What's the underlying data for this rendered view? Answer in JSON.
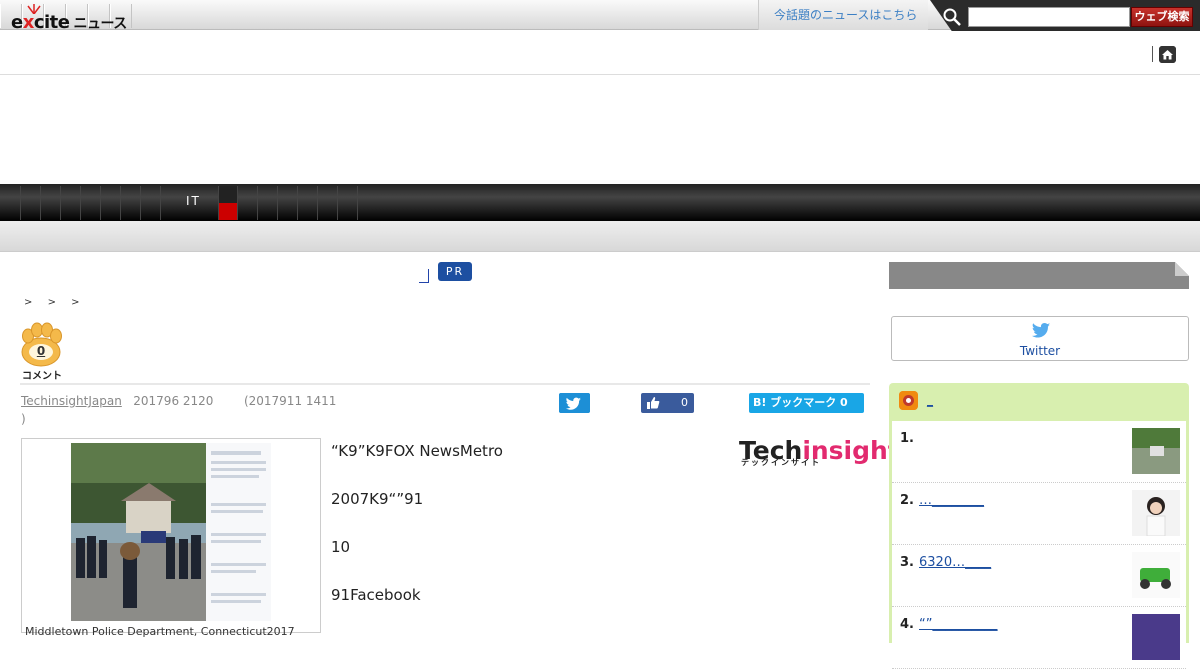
{
  "topbar": {
    "promo_link": "今話題のニュースはこちら",
    "search_placeholder": "",
    "search_button": "ウェブ検索"
  },
  "header": {
    "logo_text_a": "e",
    "logo_text_x": "x",
    "logo_text_b": "cite",
    "logo_news": "ニュース"
  },
  "category_nav": {
    "items": [
      "",
      "",
      "",
      "",
      "",
      "",
      "",
      "",
      "IT",
      "",
      "",
      "",
      "",
      "",
      "",
      "",
      ""
    ],
    "visible_label": "IT"
  },
  "article": {
    "pr_badge": "PR",
    "breadcrumb": [
      ">",
      ">",
      ">"
    ],
    "comment_count": "0",
    "comment_label": "コメント",
    "author": "TechinsightJapan",
    "date": "201796 2120",
    "updated": "(2017911 1411",
    "updated_close": ")",
    "like_count": "0",
    "hatena_label": "B! ブックマーク 0",
    "photo_caption": "Middletown Police Department, Connecticut2017",
    "paragraphs": [
      "“K9”K9FOX NewsMetro",
      "2007K9“”91",
      "10",
      "91Facebook"
    ],
    "source_logo_main": "Tech",
    "source_logo_accent": "insight",
    "source_logo_sub": "テックインサイト"
  },
  "sidebar": {
    "twitter_label": "Twitter",
    "ranking_title": "_",
    "ranking": [
      {
        "num": "1.",
        "title": ""
      },
      {
        "num": "2.",
        "title": "…________"
      },
      {
        "num": "3.",
        "title": "6320…____"
      },
      {
        "num": "4.",
        "title": "“”__________"
      }
    ]
  },
  "colors": {
    "accent_blue": "#1d4fa1",
    "search_red": "#b71e18",
    "ranking_bg": "#d8efaf",
    "twitter_blue": "#1d8fd6",
    "facebook_blue": "#3a5b9c",
    "hatena_blue": "#19a6e6"
  }
}
